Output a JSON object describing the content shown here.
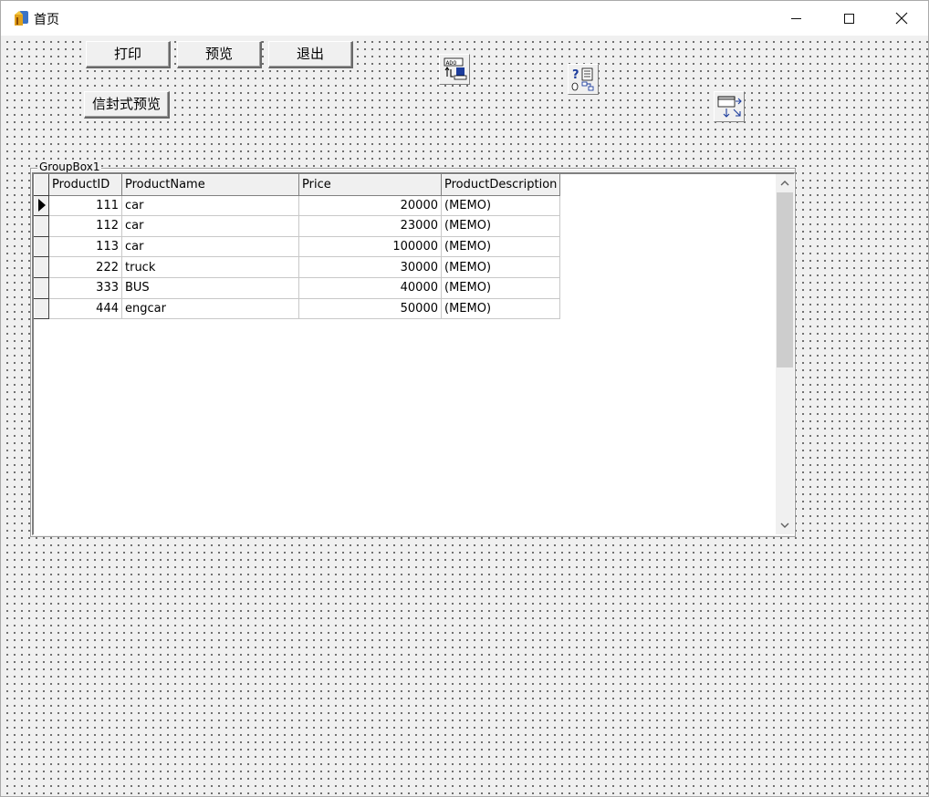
{
  "window": {
    "title": "首页",
    "icon": "delphi-app-icon"
  },
  "titlebar_buttons": {
    "minimize": "minimize-icon",
    "maximize": "maximize-icon",
    "close": "close-icon"
  },
  "toolbar": {
    "print_label": "打印",
    "preview_label": "预览",
    "exit_label": "退出",
    "envelope_preview_label": "信封式预览"
  },
  "components": [
    {
      "icon": "ado-connection-icon"
    },
    {
      "icon": "ado-query-icon"
    },
    {
      "icon": "datasource-icon"
    }
  ],
  "groupbox": {
    "caption": "GroupBox1"
  },
  "grid": {
    "columns": [
      "ProductID",
      "ProductName",
      "Price",
      "ProductDescription"
    ],
    "rows": [
      {
        "id": "111",
        "name": "car",
        "price": "20000",
        "desc": "(MEMO)"
      },
      {
        "id": "112",
        "name": "car",
        "price": "23000",
        "desc": "(MEMO)"
      },
      {
        "id": "113",
        "name": "car",
        "price": "100000",
        "desc": "(MEMO)"
      },
      {
        "id": "222",
        "name": "truck",
        "price": "30000",
        "desc": "(MEMO)"
      },
      {
        "id": "333",
        "name": "BUS",
        "price": "40000",
        "desc": "(MEMO)"
      },
      {
        "id": "444",
        "name": "engcar",
        "price": "50000",
        "desc": "(MEMO)"
      }
    ],
    "current_row": 0
  },
  "colors": {
    "face": "#f0f0f0",
    "dots": "#505050"
  }
}
